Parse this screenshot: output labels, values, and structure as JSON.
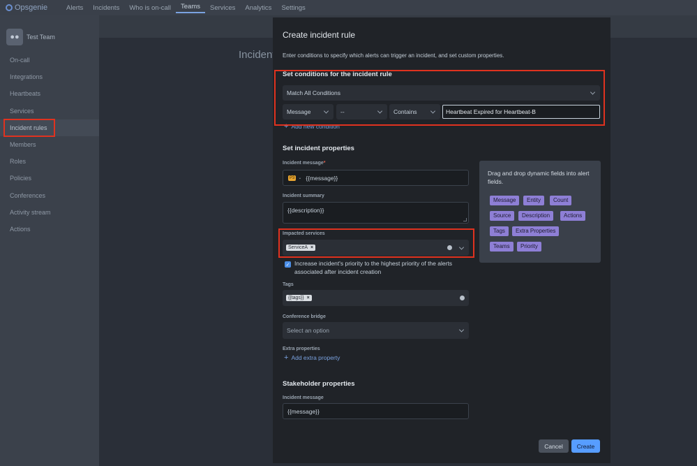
{
  "topnav": {
    "brand": "Opsgenie",
    "items": [
      "Alerts",
      "Incidents",
      "Who is on-call",
      "Teams",
      "Services",
      "Analytics",
      "Settings"
    ]
  },
  "sidebar": {
    "team_name": "Test Team",
    "items": [
      "On-call",
      "Integrations",
      "Heartbeats",
      "Services",
      "Incident rules",
      "Members",
      "Roles",
      "Policies",
      "Conferences",
      "Activity stream",
      "Actions"
    ]
  },
  "page": {
    "title": "Incident"
  },
  "modal": {
    "title": "Create incident rule",
    "description": "Enter conditions to specify which alerts can trigger an incident, and set custom properties.",
    "conditions": {
      "title": "Set conditions for the incident rule",
      "match": "Match All Conditions",
      "field": "Message",
      "not": "--",
      "operator": "Contains",
      "value": "Heartbeat Expired for Heartbeat-B",
      "add_label": "Add new condition"
    },
    "properties": {
      "title": "Set incident properties",
      "message_label": "Incident message",
      "priority_badge": "P3",
      "message_value": "{{message}}",
      "summary_label": "Incident summary",
      "summary_value": "{{description}}",
      "services_label": "Impacted services",
      "service_tag": "ServiceA",
      "priority_checkbox": "Increase incident's priority to the highest priority of the alerts associated after incident creation",
      "tags_label": "Tags",
      "tag_value": "{{tags}}",
      "bridge_label": "Conference bridge",
      "bridge_placeholder": "Select an option",
      "extra_label": "Extra properties",
      "extra_add": "Add extra property"
    },
    "stakeholder": {
      "title": "Stakeholder properties",
      "message_label": "Incident message",
      "message_value": "{{message}}"
    },
    "buttons": {
      "cancel": "Cancel",
      "create": "Create"
    }
  },
  "drag_panel": {
    "text": "Drag and drop dynamic fields into alert fields.",
    "chips": [
      "Message",
      "Entity",
      "Count",
      "Source",
      "Description",
      "Actions",
      "Tags",
      "Extra Properties",
      "Teams",
      "Priority"
    ]
  },
  "colors": {
    "accent": "#579dff",
    "chip": "#8e7fd6",
    "highlight": "#e0321f"
  }
}
